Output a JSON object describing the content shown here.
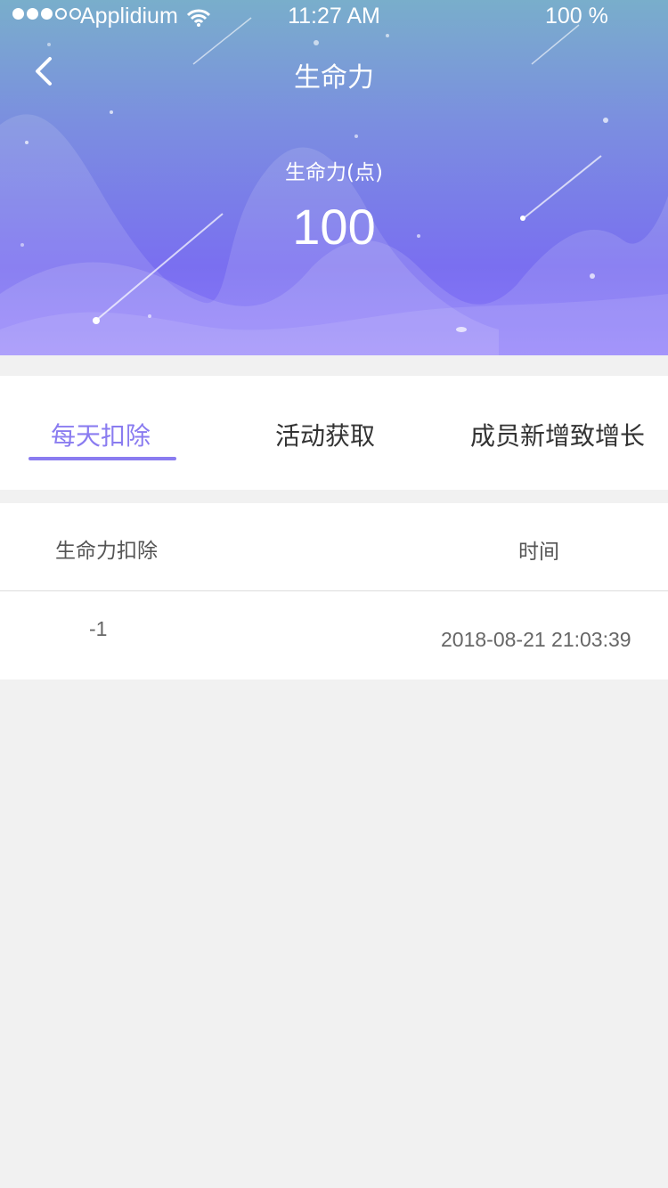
{
  "status_bar": {
    "carrier": "Applidium",
    "time": "11:27 AM",
    "battery": "100 %"
  },
  "nav": {
    "title": "生命力"
  },
  "score": {
    "label": "生命力(点)",
    "value": "100"
  },
  "tabs": [
    {
      "label": "每天扣除",
      "active": true
    },
    {
      "label": "活动获取",
      "active": false
    },
    {
      "label": "成员新增致增长",
      "active": false
    }
  ],
  "table": {
    "columns": [
      "生命力扣除",
      "时间"
    ],
    "rows": [
      {
        "change": "-1",
        "time": "2018-08-21 21:03:39"
      }
    ]
  },
  "colors": {
    "accent": "#8a7cf0",
    "header_top": "#79aecb",
    "header_bottom": "#8b78fb",
    "background": "#f1f1f1"
  }
}
